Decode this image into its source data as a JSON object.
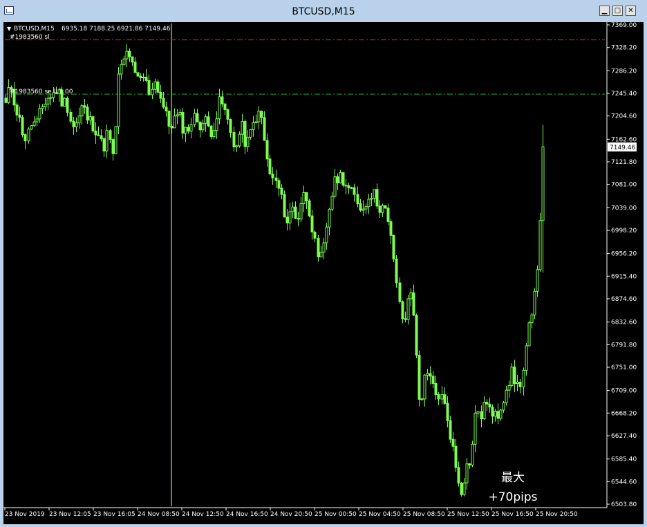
{
  "window": {
    "title": "BTCUSD,M15",
    "buttons": {
      "minimize": "▁",
      "maximize": "□",
      "close": "✕"
    }
  },
  "header": {
    "symbol": "BTCUSD,M15",
    "ohlc": "6935.18 7188.25 6921.86 7149.46",
    "order_sl_label": "#1983560 sl",
    "order_entry_label": "#1983560 se ll 1.00"
  },
  "annotation": {
    "line1": "最大",
    "line2": "+70pips"
  },
  "colors": {
    "background": "#000000",
    "candles": "#7cfc50",
    "axis_text": "#ffffff",
    "sl_line": "#dd2222",
    "entry_line": "#22aa22",
    "period_separator": "#ffff66"
  },
  "chart_data": {
    "type": "candlestick",
    "symbol": "BTCUSD",
    "timeframe": "M15",
    "ylim": [
      6503.8,
      7369.0
    ],
    "y_ticks": [
      "7369.00",
      "7328.20",
      "7286.20",
      "7245.40",
      "7204.60",
      "7162.60",
      "7121.80",
      "7081.00",
      "7039.00",
      "6998.20",
      "6956.20",
      "6915.40",
      "6874.60",
      "6832.60",
      "6791.80",
      "6751.00",
      "6709.00",
      "6668.20",
      "6627.40",
      "6585.40",
      "6544.60",
      "6503.80"
    ],
    "x_ticks": [
      "23 Nov 2019",
      "23 Nov 12:05",
      "23 Nov 16:05",
      "24 Nov 08:50",
      "24 Nov 12:50",
      "24 Nov 16:50",
      "24 Nov 20:50",
      "25 Nov 00:50",
      "25 Nov 04:50",
      "25 Nov 08:50",
      "25 Nov 12:50",
      "25 Nov 16:50",
      "25 Nov 20:50"
    ],
    "current_price": "7149.46",
    "sl_level": 7342,
    "entry_level": 7244,
    "close_path": [
      7225,
      7262,
      7220,
      7187,
      7160,
      7193,
      7189,
      7218,
      7237,
      7240,
      7253,
      7232,
      7227,
      7185,
      7193,
      7224,
      7199,
      7190,
      7176,
      7144,
      7178,
      7121,
      7275,
      7303,
      7325,
      7280,
      7266,
      7276,
      7248,
      7269,
      7248,
      7213,
      7185,
      7200,
      7202,
      7176,
      7189,
      7203,
      7190,
      7195,
      7177,
      7195,
      7236,
      7208,
      7175,
      7145,
      7189,
      7149,
      7178,
      7207,
      7201,
      7128,
      7088,
      7085,
      7047,
      7014,
      7041,
      7016,
      7062,
      7057,
      7001,
      6939,
      6958,
      7030,
      7075,
      7098,
      7092,
      7072,
      7059,
      7047,
      7034,
      7068,
      7062,
      7042,
      7039,
      7000,
      6941,
      6856,
      6828,
      6911,
      6806,
      6677,
      6732,
      6730,
      6701,
      6701,
      6674,
      6625,
      6568,
      6529,
      6569,
      6588,
      6679,
      6663,
      6693,
      6660,
      6661,
      6689,
      6721,
      6740,
      6717,
      6731,
      6812,
      6847,
      6929,
      7149
    ]
  }
}
